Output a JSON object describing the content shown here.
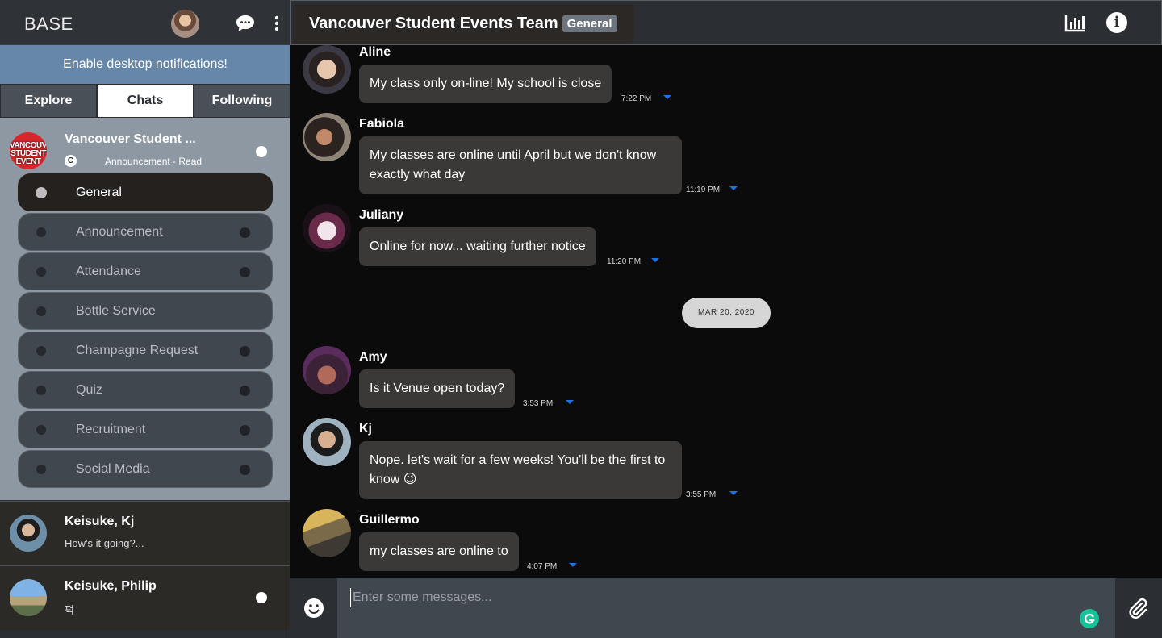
{
  "sidebar": {
    "logo": "BASE",
    "notification_banner": "Enable desktop notifications!",
    "tabs": [
      {
        "label": "Explore",
        "active": false
      },
      {
        "label": "Chats",
        "active": true
      },
      {
        "label": "Following",
        "active": false
      }
    ],
    "group": {
      "name": "Vancouver Student ...",
      "logo_text": "VANCOUVER STUDENT EVENT",
      "badge_letter": "C",
      "subtitle": "Announcement - Read",
      "channels": [
        {
          "label": "General",
          "active": true
        },
        {
          "label": "Announcement",
          "active": false,
          "unread": true
        },
        {
          "label": "Attendance",
          "active": false,
          "unread": true
        },
        {
          "label": "Bottle Service",
          "active": false,
          "unread": false
        },
        {
          "label": "Champagne Request",
          "active": false,
          "unread": true
        },
        {
          "label": "Quiz",
          "active": false,
          "unread": true
        },
        {
          "label": "Recruitment",
          "active": false,
          "unread": true
        },
        {
          "label": "Social Media",
          "active": false,
          "unread": true
        }
      ]
    },
    "direct_messages": [
      {
        "name": "Keisuke, Kj",
        "preview": "How's it going?...",
        "unread": false
      },
      {
        "name": "Keisuke, Philip",
        "preview": "퍽",
        "unread": true
      }
    ]
  },
  "header": {
    "title": "Vancouver Student Events Team",
    "channel_badge": "General"
  },
  "date_divider": "MAR 20, 2020",
  "messages": [
    {
      "author": "Aline",
      "text": "My class only on-line! My school is close",
      "time": "7:22 PM"
    },
    {
      "author": "Fabiola",
      "text": "My classes are online until April but we don't know exactly what day",
      "time": "11:19 PM"
    },
    {
      "author": "Juliany",
      "text": "Online for now... waiting further notice",
      "time": "11:20 PM"
    },
    {
      "author": "Amy",
      "text": "Is it Venue open today?",
      "time": "3:53 PM"
    },
    {
      "author": "Kj",
      "text": "Nope. let's wait for a few weeks! You'll be the first to know 😉",
      "time": "3:55 PM"
    },
    {
      "author": "Guillermo",
      "text": "my classes are online to",
      "time": "4:07 PM"
    }
  ],
  "composer": {
    "placeholder": "Enter some messages..."
  },
  "colors": {
    "notif_banner": "#6787a8",
    "group_bg": "#8d98a3",
    "bubble": "#3a3937",
    "caret": "#1a73e8"
  },
  "icons": [
    "chat-bubble-icon",
    "kebab-menu-icon",
    "bar-chart-icon",
    "info-icon",
    "emoji-icon",
    "paperclip-icon",
    "grammarly-icon"
  ]
}
